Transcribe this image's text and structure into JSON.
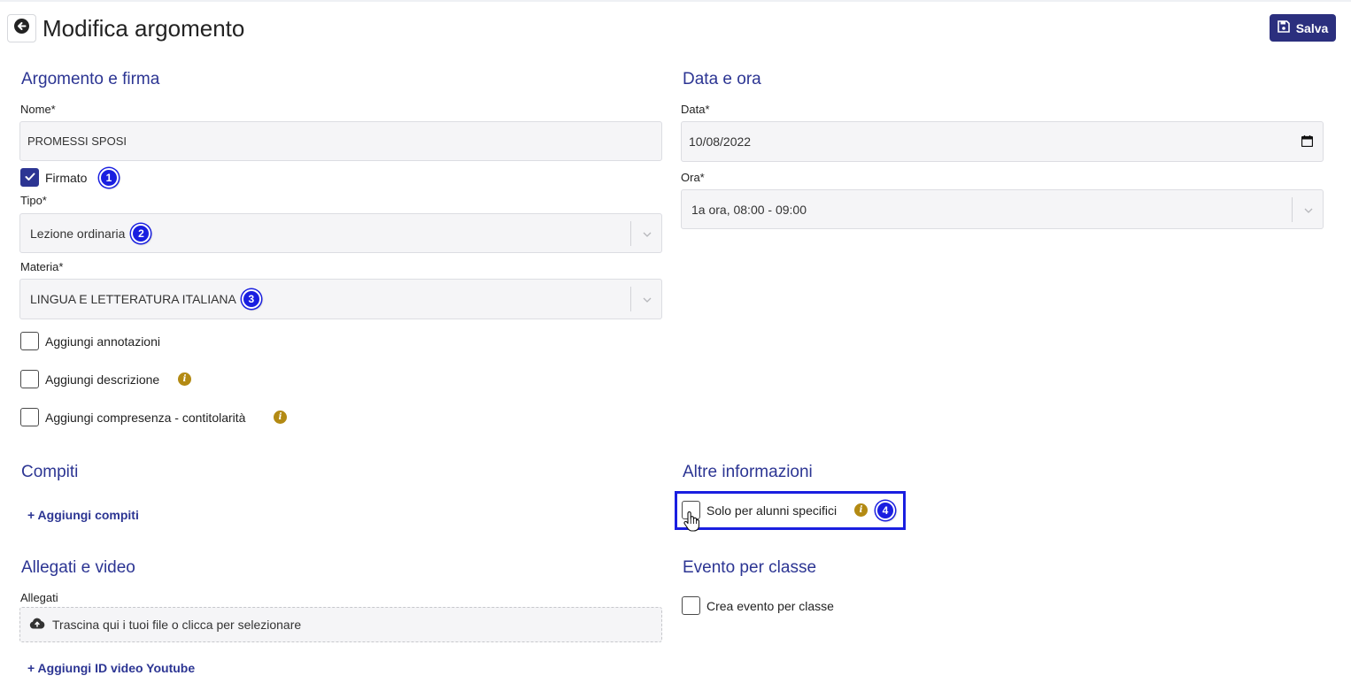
{
  "header": {
    "title": "Modifica argomento",
    "save_label": "Salva"
  },
  "left": {
    "section_title": "Argomento e firma",
    "nome": {
      "label": "Nome*",
      "value": "PROMESSI SPOSI"
    },
    "firmato": {
      "label": "Firmato",
      "checked": true,
      "step": "1"
    },
    "tipo": {
      "label": "Tipo*",
      "value": "Lezione ordinaria",
      "step": "2"
    },
    "materia": {
      "label": "Materia*",
      "value": "LINGUA E LETTERATURA ITALIANA",
      "step": "3"
    },
    "options": [
      {
        "label": "Aggiungi annotazioni",
        "checked": false,
        "info": false
      },
      {
        "label": "Aggiungi descrizione",
        "checked": false,
        "info": true
      },
      {
        "label": "Aggiungi compresenza - contitolarità",
        "checked": false,
        "info": true
      }
    ]
  },
  "right": {
    "section_title": "Data e ora",
    "data": {
      "label": "Data*",
      "value": "10/08/2022"
    },
    "ora": {
      "label": "Ora*",
      "value": "1a ora, 08:00 - 09:00"
    }
  },
  "compiti": {
    "section_title": "Compiti",
    "add_link": "+ Aggiungi compiti"
  },
  "altre_info": {
    "section_title": "Altre informazioni",
    "solo_alunni": {
      "label": "Solo per alunni specifici",
      "checked": false,
      "step": "4"
    }
  },
  "allegati": {
    "section_title": "Allegati e video",
    "label": "Allegati",
    "dropzone_text": "Trascina qui i tuoi file o clicca per selezionare",
    "add_video_link": "+ Aggiungi ID video Youtube"
  },
  "evento": {
    "section_title": "Evento per classe",
    "crea_evento": {
      "label": "Crea evento per classe",
      "checked": false
    }
  },
  "colors": {
    "accent": "#2c3593",
    "save_button": "#2b2f7e",
    "step_marker": "#1a1fe0",
    "info_icon": "#b38a13"
  }
}
